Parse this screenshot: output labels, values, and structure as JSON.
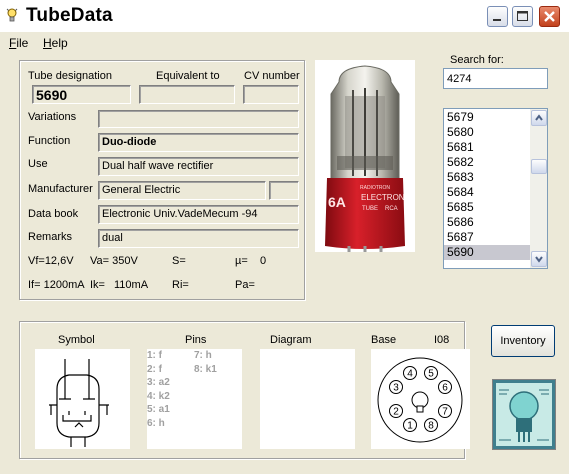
{
  "window": {
    "title": "TubeData"
  },
  "menu": {
    "file": "File",
    "file_key": "F",
    "file_rest": "ile",
    "help": "Help",
    "help_key": "H",
    "help_rest": "elp"
  },
  "labels": {
    "tube_designation": "Tube designation",
    "equivalent_to": "Equivalent to",
    "cv_number": "CV number",
    "variations": "Variations",
    "function": "Function",
    "use": "Use",
    "manufacturer": "Manufacturer",
    "data_book": "Data book",
    "remarks": "Remarks",
    "search_for": "Search for:",
    "symbol": "Symbol",
    "pins": "Pins",
    "diagram": "Diagram",
    "base": "Base",
    "base_type": "I08",
    "inventory": "Inventory"
  },
  "tube": {
    "designation": "5690",
    "equivalent": "",
    "cv_number": "",
    "variations": "",
    "function": "Duo-diode",
    "use": "Dual half wave rectifier",
    "manufacturer": "General Electric",
    "manufacturer_extra": "",
    "data_book": "Electronic Univ.VadeMecum -94",
    "remarks": "dual"
  },
  "params": {
    "vf": "Vf=12,6V",
    "va": "Va= 350V",
    "s": "S=",
    "mu": "µ=",
    "mu_val": "0",
    "if": "If= 1200mA",
    "ik": "Ik=",
    "ik_val": "110mA",
    "ri": "Ri=",
    "pa": "Pa="
  },
  "search": {
    "value": "4274"
  },
  "list": {
    "items": [
      "5679",
      "5680",
      "5681",
      "5682",
      "5683",
      "5684",
      "5685",
      "5686",
      "5687",
      "5690"
    ],
    "selected": "5690"
  },
  "pins": {
    "col1": [
      "1: f",
      "2: f",
      "3: a2",
      "4: k2",
      "5: a1",
      "6: h"
    ],
    "col2": [
      "7: h",
      "8: k1"
    ]
  },
  "base_pins": [
    "1",
    "2",
    "3",
    "4",
    "5",
    "6",
    "7",
    "8"
  ],
  "photo": {
    "brand": "RADIOTRON",
    "line": "ELECTRON",
    "tube": "TUBE",
    "mark": "RCA",
    "partial": "6A"
  },
  "colors": {
    "accent": "#7f9db9",
    "close": "#c2411c",
    "tube_base": "#c0101a"
  }
}
